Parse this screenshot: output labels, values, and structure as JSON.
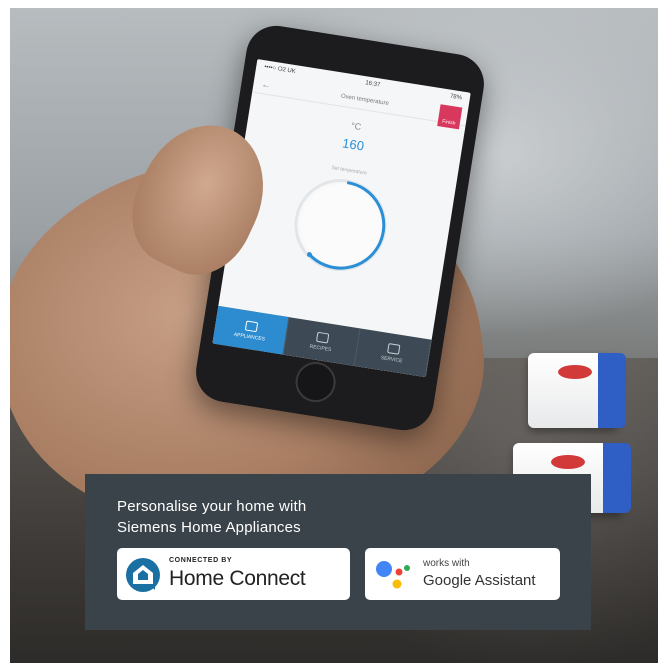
{
  "app": {
    "status": {
      "carrier": "••••○ O2 UK",
      "time": "16:37",
      "battery": "78%"
    },
    "header": {
      "title": "Oven temperature",
      "badge_label": "Finish"
    },
    "temperature": {
      "label": "°C",
      "value": "160"
    },
    "dial_caption": "Set temperature",
    "tabs": [
      {
        "label": "APPLIANCES",
        "active": true
      },
      {
        "label": "RECIPES",
        "active": false
      },
      {
        "label": "SERVICE",
        "active": false
      }
    ]
  },
  "panel": {
    "tagline": "Personalise your home with\nSiemens Home Appliances",
    "home_connect": {
      "small": "CONNECTED BY",
      "big": "Home Connect",
      "logo_color": "#1a6fa3"
    },
    "google": {
      "small": "works with",
      "big": "Google Assistant",
      "dot_colors": [
        "#4285f4",
        "#ea4335",
        "#fbbc05",
        "#34a853"
      ]
    }
  },
  "colors": {
    "panel_bg": "#394349",
    "app_accent": "#2b8fd6",
    "header_badge": "#d9385e"
  }
}
